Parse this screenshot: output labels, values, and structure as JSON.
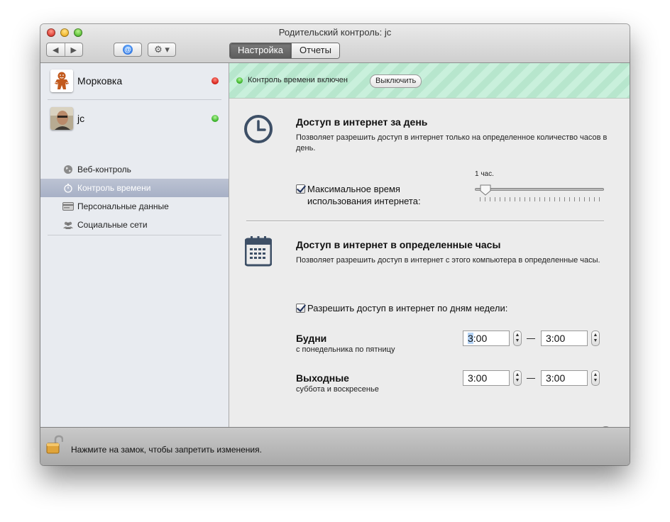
{
  "window": {
    "title": "Родительский контроль: jc"
  },
  "toolbar": {
    "back_label": "◀",
    "forward_label": "▶",
    "at_label": "@",
    "gear_label": "⚙︎ ▾",
    "tabs": [
      {
        "label": "Настройка",
        "active": true
      },
      {
        "label": "Отчеты",
        "active": false
      }
    ]
  },
  "sidebar": {
    "users": [
      {
        "name": "Морковка",
        "status": "red",
        "avatar_icon": "gingerbread-icon"
      },
      {
        "name": "jc",
        "status": "green",
        "avatar_icon": "person-photo-icon"
      }
    ],
    "items": [
      {
        "label": "Веб-контроль",
        "icon": "globe-icon"
      },
      {
        "label": "Контроль времени",
        "icon": "stopwatch-icon",
        "selected": true
      },
      {
        "label": "Персональные данные",
        "icon": "card-icon"
      },
      {
        "label": "Социальные сети",
        "icon": "people-icon"
      }
    ]
  },
  "banner": {
    "status_text": "Контроль времени включен",
    "button_label": "Выключить"
  },
  "daily": {
    "title": "Доступ в интернет за день",
    "description": "Позволяет разрешить доступ в интернет только на определенное количество часов в день.",
    "checkbox_label": "Максимальное время использования интернета:",
    "checked": true,
    "slider_value_label": "1 час.",
    "slider_fraction": 0.04
  },
  "hours": {
    "title": "Доступ в интернет в определенные часы",
    "description": "Позволяет разрешить доступ в интернет с этого компьютера в определенные часы.",
    "checkbox_label": "Разрешить доступ в интернет по дням недели:",
    "checked": true,
    "weekdays": {
      "title": "Будни",
      "subtitle": "с понедельника по пятницу",
      "from_hour": "3",
      "from_rest": ":00",
      "to": "3:00"
    },
    "weekends": {
      "title": "Выходные",
      "subtitle": "суббота и воскресенье",
      "from": "3:00",
      "to": "3:00"
    }
  },
  "help_label": "?",
  "footer": {
    "lock_text": "Нажмите на замок, чтобы запретить изменения."
  },
  "colors": {
    "accent_green": "#3bb52a",
    "status_red": "#d6221a",
    "selection": "#a7b0c6"
  }
}
